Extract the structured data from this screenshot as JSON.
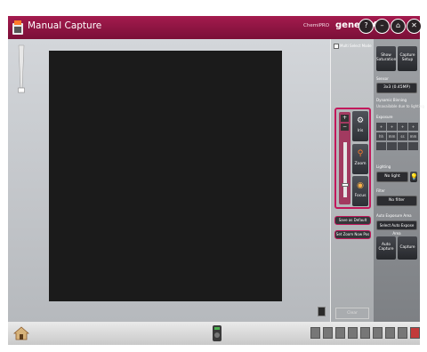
{
  "titlebar": {
    "title": "Manual Capture",
    "brand_small": "ChemiPRO",
    "brand_big": "genePIX",
    "buttons": [
      {
        "icon": "help-icon",
        "glyph": "?"
      },
      {
        "icon": "minimize-icon",
        "glyph": "–"
      },
      {
        "icon": "home-icon",
        "glyph": "⌂"
      },
      {
        "icon": "close-icon",
        "glyph": "✕"
      }
    ]
  },
  "mid_panel": {
    "multi_select_label": "Multi Select Mode",
    "zoom_plus": "+",
    "zoom_minus": "−",
    "iris_label": "Iris",
    "zoom_label": "Zoom",
    "focus_label": "Focus",
    "save_default_label": "Save as Default",
    "set_zoom_label": "Set Zoom Now Pos",
    "clear_label": "Clear"
  },
  "right_panel": {
    "show_saturation": "Show Saturation",
    "capture_setup": "Capture Setup",
    "sensor_label": "Sensor",
    "sensor_value": "3x3 (0.45MP)",
    "dynamic_binning_label": "Dynamic Binning",
    "dynamic_binning_value": "Unavailable due to lighting",
    "exposure_label": "Exposure",
    "exposure_row1": [
      "+",
      "+",
      "+",
      "+"
    ],
    "exposure_row2": [
      "hh",
      "mm",
      "ss",
      "mm"
    ],
    "lighting_label": "Lighting",
    "lighting_value": "No light",
    "filter_label": "Filter",
    "filter_value": "No filter",
    "auto_exposure_label": "Auto Exposure Area",
    "auto_exposure_value": "Select Auto Expose Area",
    "auto_capture": "Auto Capture",
    "capture": "Capture"
  },
  "colors": {
    "accent": "#c2185b",
    "titlebar": "#941644",
    "image_bg": "#1b1b1b",
    "panel_gray": "#c4c7ca"
  }
}
